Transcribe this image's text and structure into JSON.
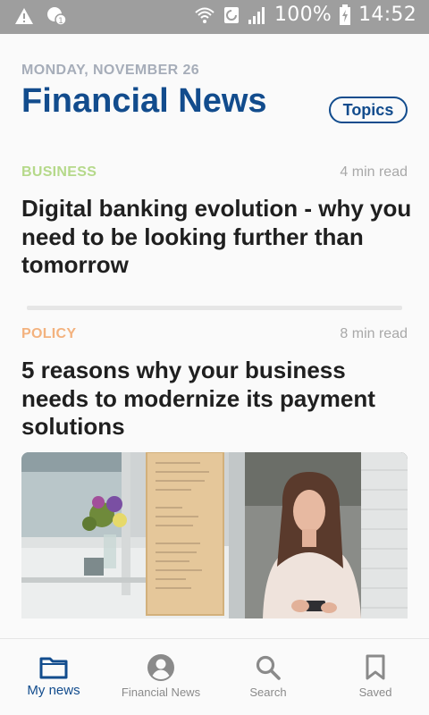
{
  "status_bar": {
    "battery": "100%",
    "time": "14:52"
  },
  "header": {
    "date": "MONDAY, NOVEMBER 26",
    "title": "Financial News",
    "topics_label": "Topics"
  },
  "articles": [
    {
      "category": "BUSINESS",
      "category_color": "#b5d98a",
      "read_time": "4 min read",
      "headline": "Digital banking evolution - why you need to be looking further than tomorrow"
    },
    {
      "category": "POLICY",
      "category_color": "#f3b27e",
      "read_time": "8 min read",
      "headline": "5 reasons why your business needs to modernize its payment solutions"
    }
  ],
  "bottom_nav": [
    {
      "label": "My news",
      "icon": "folder-icon",
      "active": true
    },
    {
      "label": "Financial News",
      "icon": "account-circle-icon",
      "active": false
    },
    {
      "label": "Search",
      "icon": "search-icon",
      "active": false
    },
    {
      "label": "Saved",
      "icon": "bookmark-icon",
      "active": false
    }
  ],
  "colors": {
    "brand": "#124c8d",
    "status_bar": "#9e9e9e",
    "inactive": "#8a8a8a"
  }
}
